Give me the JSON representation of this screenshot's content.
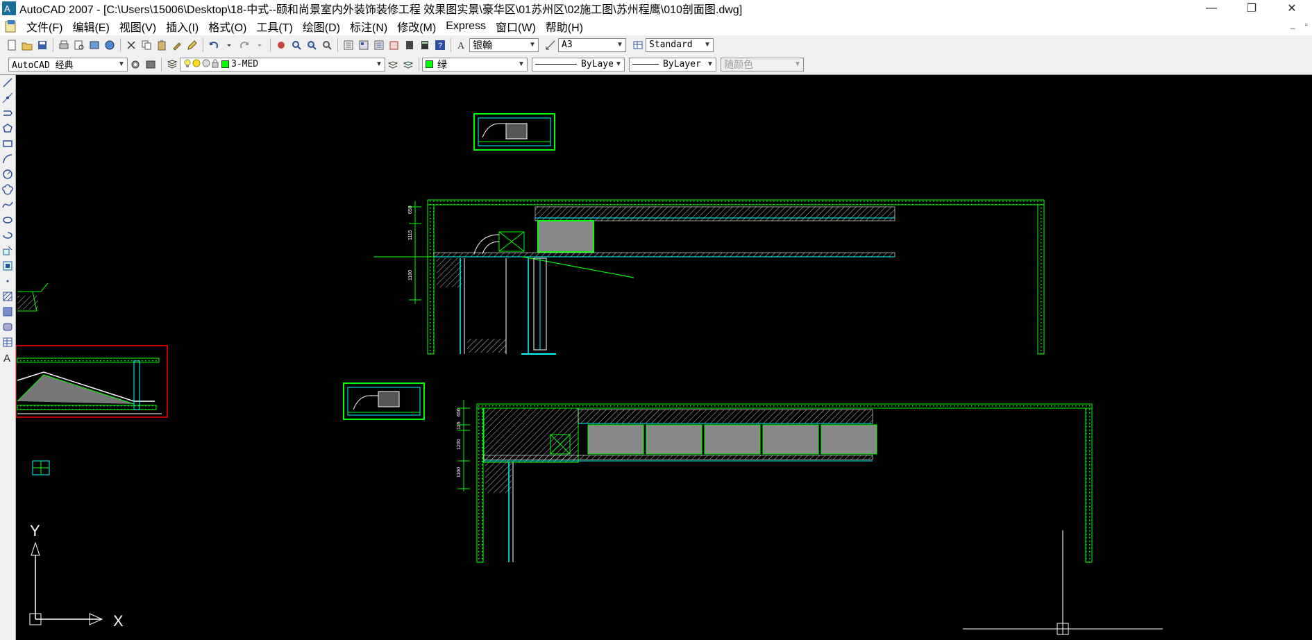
{
  "window": {
    "title": "AutoCAD 2007 - [C:\\Users\\15006\\Desktop\\18-中式--颐和尚景室内外装饰装修工程 效果图实景\\豪华区\\01苏州区\\02施工图\\苏州程鹰\\010剖面图.dwg]",
    "minimize": "—",
    "maximize": "❐",
    "close": "✕"
  },
  "menu": {
    "items": [
      "文件(F)",
      "编辑(E)",
      "视图(V)",
      "插入(I)",
      "格式(O)",
      "工具(T)",
      "绘图(D)",
      "标注(N)",
      "修改(M)",
      "Express",
      "窗口(W)",
      "帮助(H)"
    ],
    "mdi_min": "_",
    "mdi_restore": "▫"
  },
  "toolbar1": {
    "text_style": "银翰",
    "dim_style": "A3",
    "table_style": "Standard"
  },
  "toolbar2": {
    "workspace": "AutoCAD 经典",
    "layer": "3-MED",
    "color": "绿",
    "linetype": "ByLayer",
    "lineweight": "ByLayer",
    "plotstyle": "随颜色",
    "layer_color": "#00ff00"
  },
  "ucs": {
    "x_label": "X",
    "y_label": "Y"
  },
  "dims": {
    "d1": "650",
    "d2": "1115",
    "d3": "1100",
    "d4": "650",
    "d5": "125",
    "d6": "1200",
    "d7": "1100"
  },
  "colors": {
    "green": "#00ff00",
    "cyan": "#00ffff",
    "white": "#ffffff",
    "red": "#ff0000",
    "gray": "#808080"
  }
}
